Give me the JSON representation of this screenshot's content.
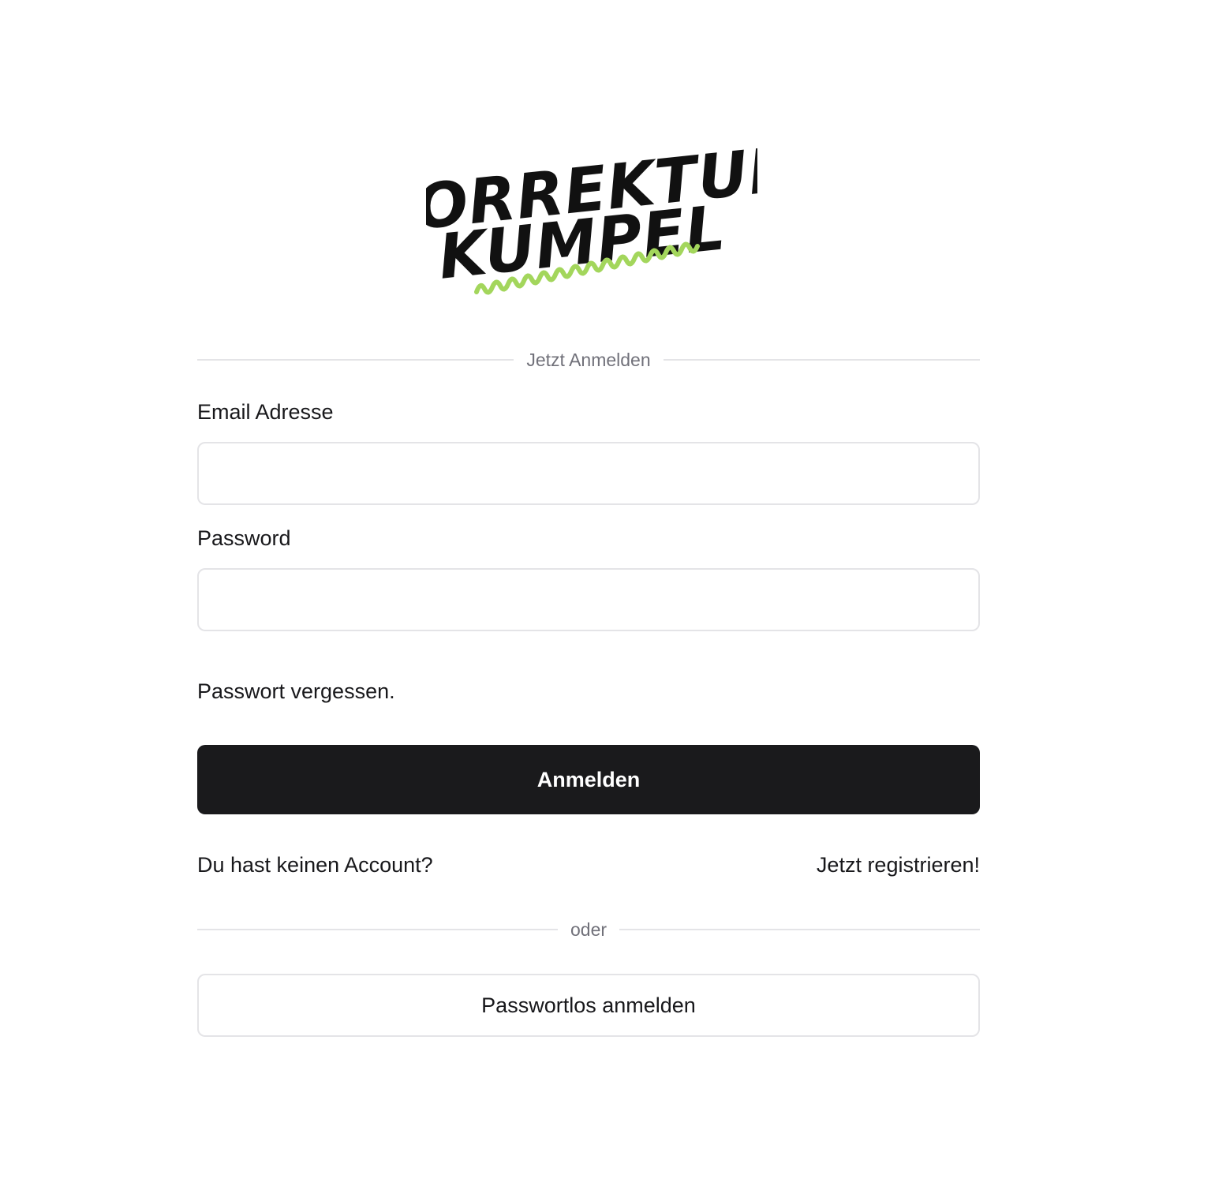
{
  "logo": {
    "line1": "KORREKTUR",
    "line2": "KUMPEL",
    "squiggle_color": "#a3d65c",
    "text_color": "#111111"
  },
  "login": {
    "divider_label": "Jetzt Anmelden",
    "email_label": "Email Adresse",
    "email_value": "",
    "password_label": "Password",
    "password_value": "",
    "forgot_password": "Passwort vergessen.",
    "submit_label": "Anmelden"
  },
  "register": {
    "prompt": "Du hast keinen Account?",
    "link": "Jetzt registrieren!"
  },
  "alternative": {
    "divider_label": "oder",
    "passwordless_label": "Passwortlos anmelden"
  },
  "colors": {
    "primary_button": "#1a1a1c",
    "border": "#e4e4e7",
    "muted_text": "#71717a",
    "accent": "#a3d65c"
  }
}
